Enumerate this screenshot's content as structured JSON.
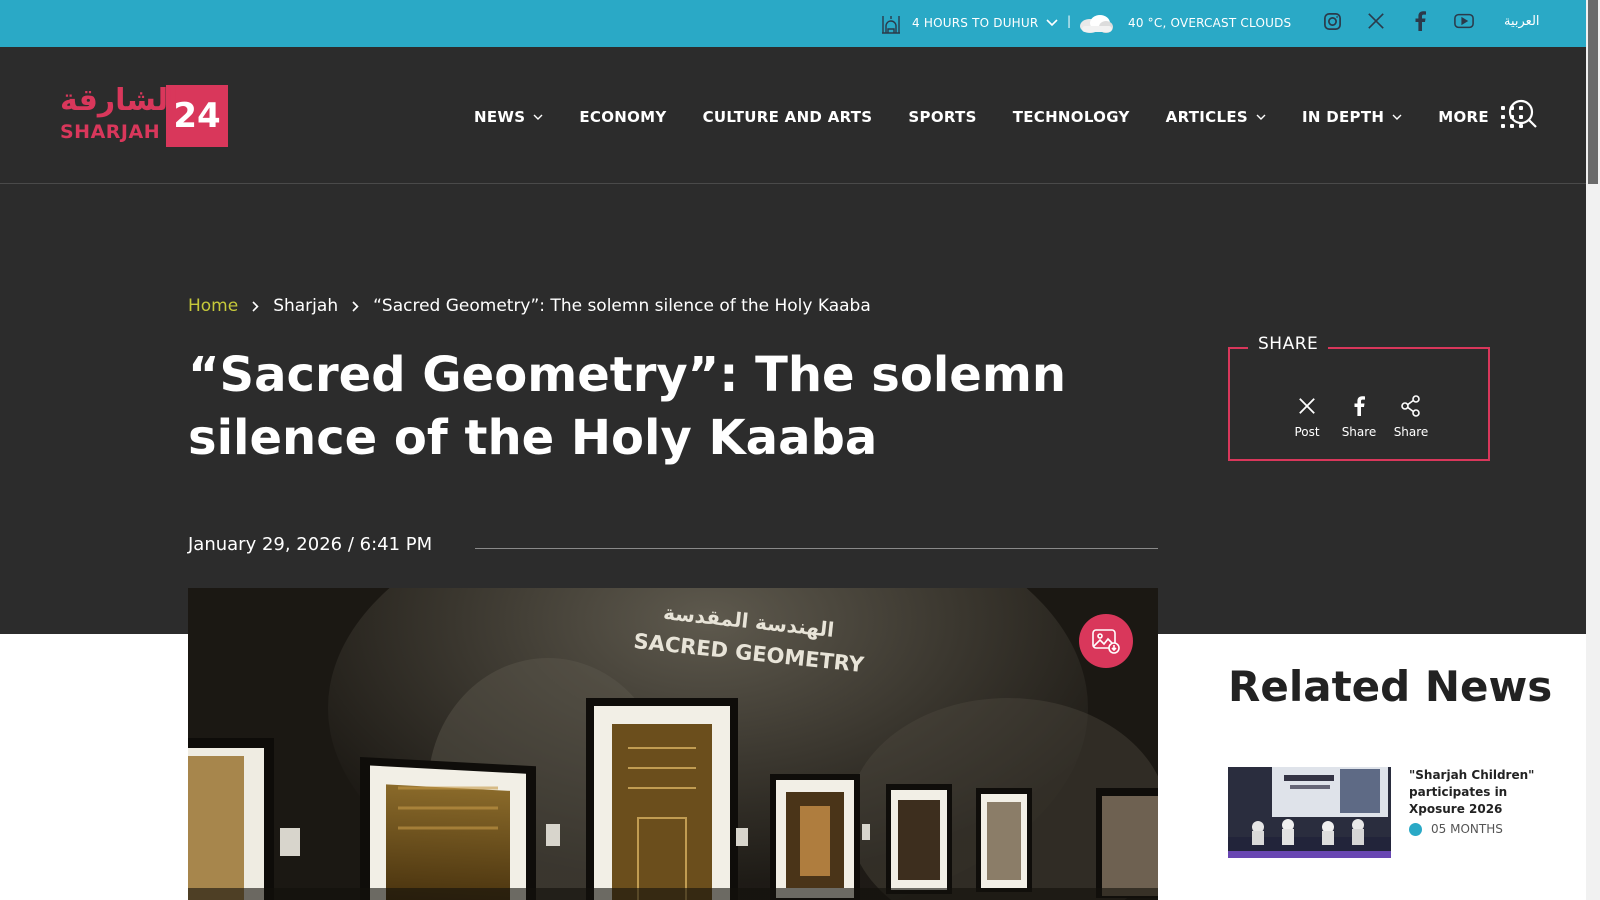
{
  "topbar": {
    "prayer_text": "4 HOURS TO DUHUR",
    "separator": "|",
    "weather_text": "40 °C, OVERCAST CLOUDS",
    "social_icons": [
      "instagram-icon",
      "x-icon",
      "facebook-icon",
      "youtube-icon"
    ],
    "language": "العربية"
  },
  "header": {
    "logo_arabic": "الشارقة",
    "logo_english": "SHARJAH",
    "logo_number": "24",
    "nav": [
      {
        "label": "NEWS",
        "dropdown": true
      },
      {
        "label": "ECONOMY",
        "dropdown": false
      },
      {
        "label": "CULTURE AND ARTS",
        "dropdown": false
      },
      {
        "label": "SPORTS",
        "dropdown": false
      },
      {
        "label": "TECHNOLOGY",
        "dropdown": false
      },
      {
        "label": "ARTICLES",
        "dropdown": true
      },
      {
        "label": "IN DEPTH",
        "dropdown": true
      },
      {
        "label": "MORE",
        "dropdown": false
      }
    ]
  },
  "article": {
    "breadcrumb": [
      "Home",
      "Sharjah",
      "“Sacred Geometry”: The solemn silence of the Holy Kaaba"
    ],
    "title": "“Sacred Geometry”: The solemn silence of the Holy Kaaba",
    "date": "January 29, 2026 / 6:41 PM",
    "image_caption_arabic": "الهندسة المقدسة",
    "image_caption_english": "SACRED GEOMETRY"
  },
  "share": {
    "title": "SHARE",
    "items": [
      {
        "icon": "x-icon",
        "label": "Post"
      },
      {
        "icon": "facebook-icon",
        "label": "Share"
      },
      {
        "icon": "share-icon",
        "label": "Share"
      }
    ]
  },
  "related": {
    "title": "Related News",
    "items": [
      {
        "headline": "\"Sharjah Children\" participates in Xposure 2026",
        "time": "05 MONTHS"
      }
    ]
  },
  "colors": {
    "topbar": "#2aa9c6",
    "header": "#2c2c2c",
    "accent": "#d9375b",
    "breadcrumb_home": "#c6c93a"
  }
}
